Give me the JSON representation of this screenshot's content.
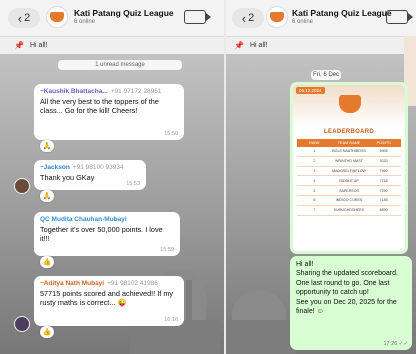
{
  "header": {
    "back_count": "2",
    "group_name": "Kati Patang Quiz League",
    "group_sub": "6 online"
  },
  "pinned": {
    "icon": "pin-icon",
    "text": "Hi all!"
  },
  "left_chat": {
    "unread_label": "1 unread message",
    "messages": [
      {
        "sender": "~Kaushik Bhattacha...",
        "phone": "+91 97172 28961",
        "sender_color": "#6b5bd6",
        "text": "All the very best to the toppers of the class... Go for the kill! Cheers!",
        "time": "15:50",
        "reaction": "🙏"
      },
      {
        "sender": "~Jackson",
        "phone": "+91 98100 93934",
        "sender_color": "#2a7fd4",
        "text": "Thank you GKay",
        "time": "15:53",
        "reaction": "🙏"
      },
      {
        "sender": "QC Mudita Chauhan-Mubayi",
        "phone": "",
        "sender_color": "#2f8fd1",
        "text": "Together it's over 50,000 points. I love it!!!",
        "time": "15:59",
        "reaction": "👍"
      },
      {
        "sender": "~Aditya Nath Mubayi",
        "phone": "+91 98102 41986",
        "sender_color": "#d4601f",
        "text": "57715 points scored and achieved!! If my rusty maths is correct... 😜",
        "time": "16:16",
        "reaction": "👍"
      }
    ]
  },
  "right_chat": {
    "date_chip": "Fri, 6 Dec",
    "poster": {
      "date_tag": "06.12.2024",
      "title": "LEADERBOARD",
      "columns": [
        "RANK",
        "TEAM NAME",
        "POINTS"
      ],
      "rows": [
        [
          "1",
          "BOLE NAATHIBOSS",
          "9905"
        ],
        [
          "2",
          "WRINTHD MAST",
          "9220"
        ],
        [
          "3",
          "MADOSELF@FLOW",
          "7990"
        ],
        [
          "4",
          "RIDDLE UP",
          "7745"
        ],
        [
          "5",
          "SAPERSOS",
          "7290"
        ],
        [
          "6",
          "INDIGO CORES",
          "7185"
        ],
        [
          "7",
          "KURUGHDSHEES",
          "6890"
        ]
      ]
    },
    "text_lines": [
      "Hi all!",
      "Sharing the updated scoreboard.",
      "One last round to go. One last opportunity to catch up!",
      "See you on Dec 20, 2025 for the finale! ☺"
    ],
    "time": "17:26 ✓✓"
  },
  "colors": {
    "accent": "#e57a2f",
    "outgoing_bubble": "#d9fdd3",
    "incoming_bubble": "#ffffff"
  }
}
